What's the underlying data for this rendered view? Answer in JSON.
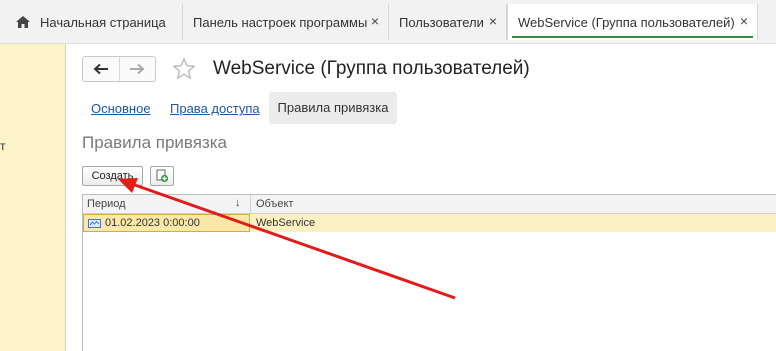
{
  "tabs": {
    "home_label": "Начальная страница",
    "items": [
      {
        "label": "Панель настроек программы",
        "close": "×"
      },
      {
        "label": "Пользователи",
        "close": "×"
      },
      {
        "label": "WebService (Группа пользователей)",
        "close": "×"
      }
    ]
  },
  "left_panel": {
    "fragment": "т"
  },
  "form": {
    "title": "WebService (Группа пользователей)",
    "sections": [
      {
        "label": "Основное",
        "active": false
      },
      {
        "label": "Права доступа",
        "active": false
      },
      {
        "label": "Правила привязка",
        "active": true
      }
    ],
    "section_heading": "Правила привязка"
  },
  "toolbar": {
    "create_label": "Создать",
    "copy_icon": "copy-add-icon"
  },
  "table": {
    "columns": [
      {
        "label": "Период",
        "sort": "↓"
      },
      {
        "label": "Объект"
      }
    ],
    "rows": [
      {
        "period": "01.02.2023 0:00:00",
        "object": "WebService"
      }
    ]
  },
  "colors": {
    "accent_green": "#3c8b3c",
    "link_blue": "#1f56a8",
    "selection_yellow": "#fbe7a6",
    "annotation_red": "#e31b1b"
  }
}
